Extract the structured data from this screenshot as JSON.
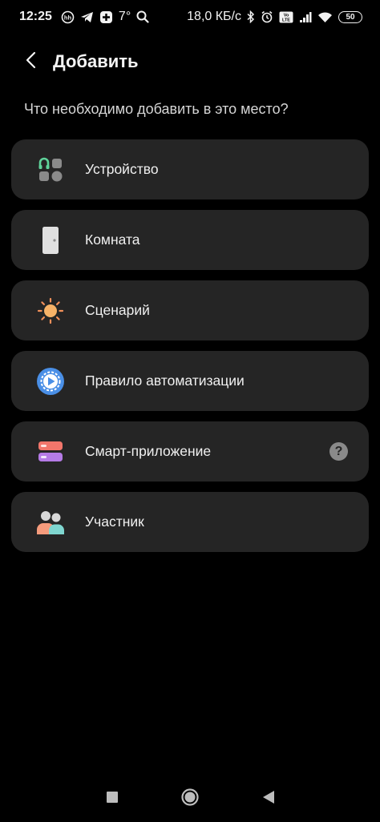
{
  "status_bar": {
    "time": "12:25",
    "temperature": "7°",
    "network_speed": "18,0 КБ/с",
    "battery_level": "50",
    "icons": [
      "hh-icon",
      "telegram-icon",
      "app-icon",
      "search-icon",
      "bluetooth-icon",
      "alarm-icon",
      "volte-icon",
      "signal-icon",
      "wifi-icon",
      "battery-icon"
    ]
  },
  "header": {
    "title": "Добавить",
    "back_icon": "chevron-left-icon"
  },
  "subtitle": "Что необходимо добавить в это место?",
  "options": [
    {
      "label": "Устройство",
      "icon": "device-grid-icon"
    },
    {
      "label": "Комната",
      "icon": "door-icon"
    },
    {
      "label": "Сценарий",
      "icon": "sun-icon"
    },
    {
      "label": "Правило автоматизации",
      "icon": "play-clock-icon"
    },
    {
      "label": "Смарт-приложение",
      "icon": "smartapp-icon",
      "help": "?"
    },
    {
      "label": "Участник",
      "icon": "members-icon"
    }
  ],
  "nav_bar": [
    "recents-icon",
    "home-icon",
    "back-icon"
  ],
  "colors": {
    "background": "#000000",
    "card": "#252525",
    "text": "#f0f0f0",
    "subtitle_text": "#d6d6d6"
  }
}
